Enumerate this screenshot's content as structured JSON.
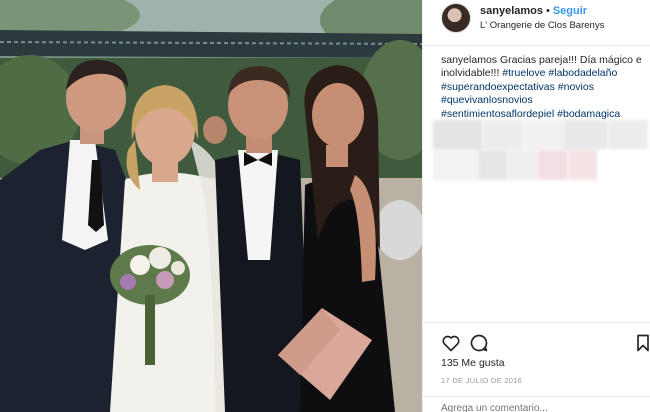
{
  "post": {
    "username": "sanyelamos",
    "separator": "•",
    "follow_label": "Seguir",
    "location": "L' Orangerie de Clos Barenys"
  },
  "caption": {
    "username": "sanyelamos",
    "text": "Gracias pareja!!! Día mágico e inolvidable!!!",
    "hashtags": [
      "#truelove",
      "#labodadelaño",
      "#superandoexpectativas",
      "#novios",
      "#quevivanlosnovios",
      "#sentimientosaflordepiel",
      "#bodamagica"
    ]
  },
  "actions": {
    "like_icon": "heart-icon",
    "comment_icon": "speech-bubble-icon",
    "save_icon": "bookmark-icon"
  },
  "likes_text": "135 Me gusta",
  "date_text": "17 DE JULIO DE 2016",
  "comment_placeholder": "Agrega un comentario...",
  "colors": {
    "follow": "#3897f0",
    "hashtag": "#003569",
    "muted": "#999999"
  }
}
